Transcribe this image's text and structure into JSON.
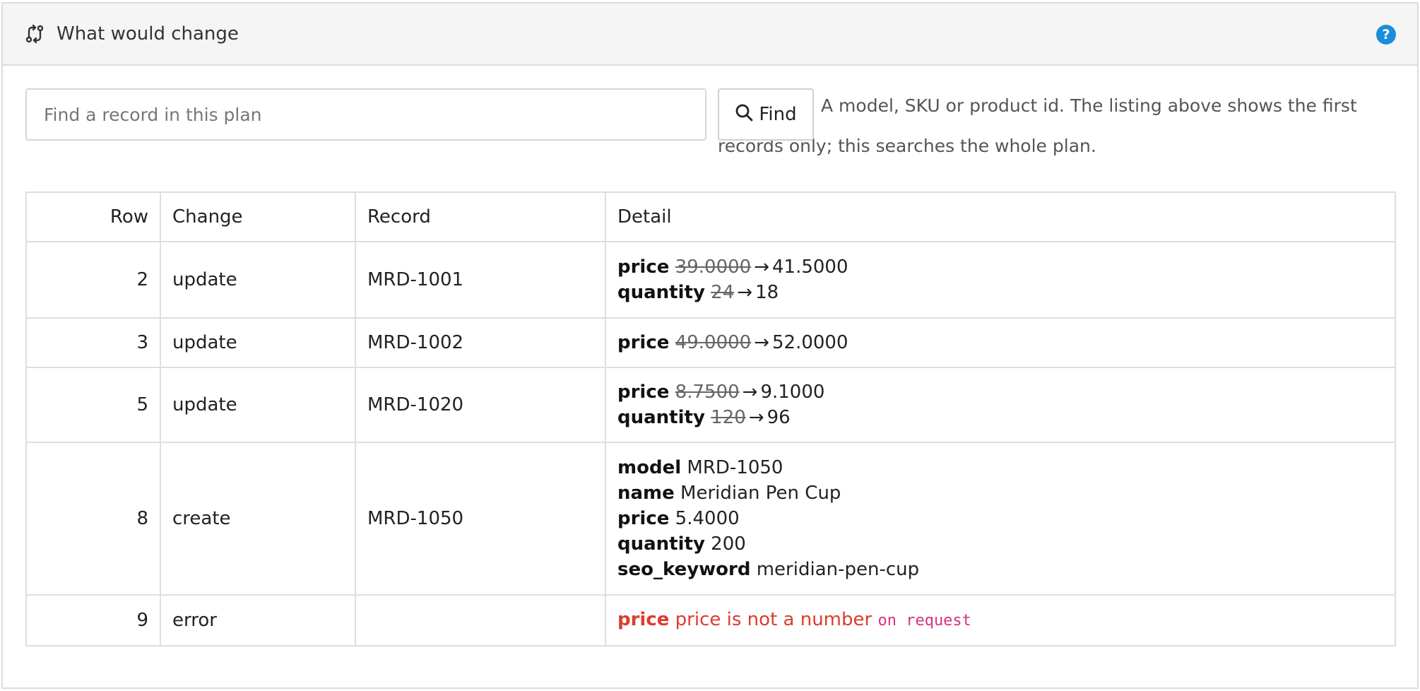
{
  "header": {
    "title": "What would change",
    "help_label": "?"
  },
  "search": {
    "placeholder": "Find a record in this plan",
    "value": "",
    "button_label": "Find",
    "help_text": "A model, SKU or product id. The listing above shows the first records only; this searches the whole plan."
  },
  "table": {
    "columns": [
      "Row",
      "Change",
      "Record",
      "Detail"
    ],
    "rows": [
      {
        "row": "2",
        "change": "update",
        "record": "MRD-1001",
        "details": [
          {
            "field": "price",
            "old": "39.0000",
            "new": "41.5000"
          },
          {
            "field": "quantity",
            "old": "24",
            "new": "18"
          }
        ]
      },
      {
        "row": "3",
        "change": "update",
        "record": "MRD-1002",
        "details": [
          {
            "field": "price",
            "old": "49.0000",
            "new": "52.0000"
          }
        ]
      },
      {
        "row": "5",
        "change": "update",
        "record": "MRD-1020",
        "details": [
          {
            "field": "price",
            "old": "8.7500",
            "new": "9.1000"
          },
          {
            "field": "quantity",
            "old": "120",
            "new": "96"
          }
        ]
      },
      {
        "row": "8",
        "change": "create",
        "record": "MRD-1050",
        "details": [
          {
            "field": "model",
            "value": "MRD-1050"
          },
          {
            "field": "name",
            "value": "Meridian Pen Cup"
          },
          {
            "field": "price",
            "value": "5.4000"
          },
          {
            "field": "quantity",
            "value": "200"
          },
          {
            "field": "seo_keyword",
            "value": "meridian-pen-cup"
          }
        ]
      },
      {
        "row": "9",
        "change": "error",
        "record": "",
        "error": {
          "field": "price",
          "message": "price is not a number",
          "context": "on request"
        }
      }
    ]
  },
  "colors": {
    "error": "#dc3c2e",
    "code": "#d63384",
    "help_badge": "#1a8ed8"
  },
  "icons": {
    "header": "compare-arrows-icon",
    "find": "search-icon",
    "help": "help-circle-icon"
  }
}
